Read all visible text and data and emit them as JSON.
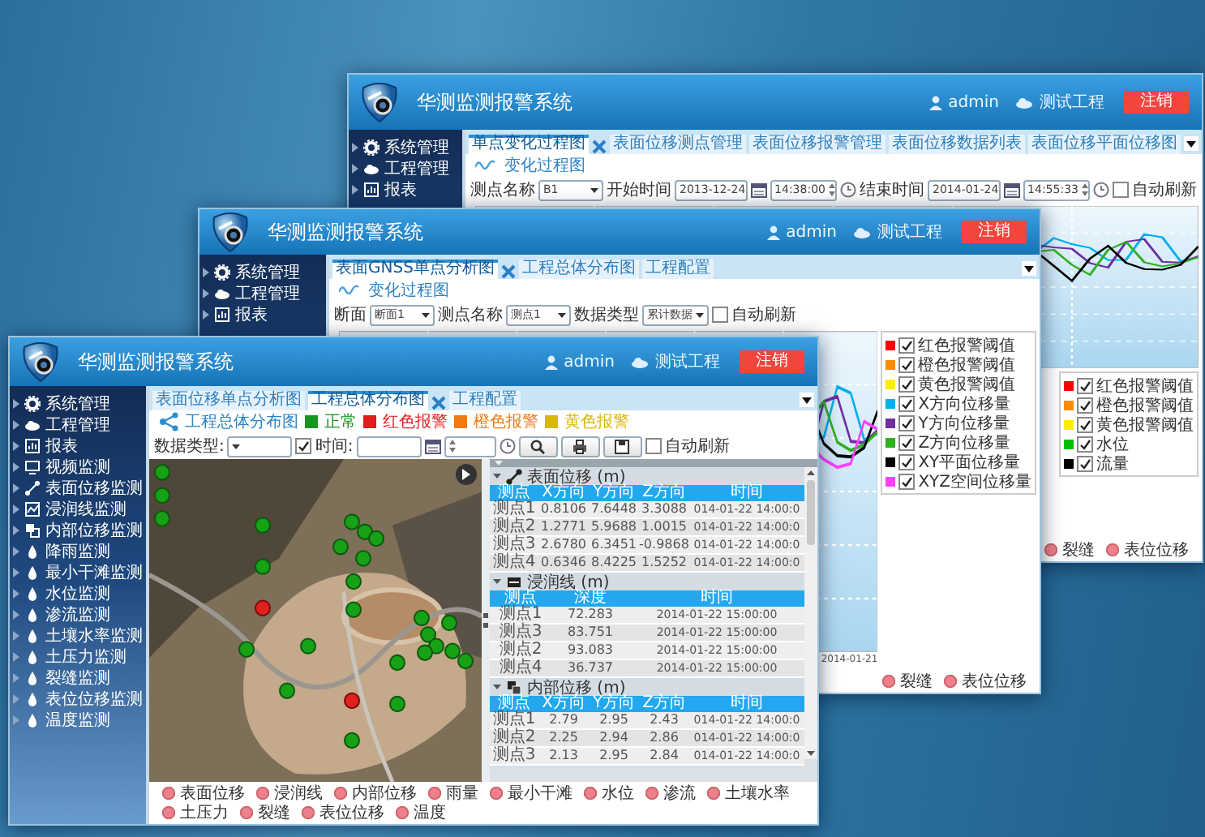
{
  "windows": [
    {
      "title": "华测监测报警系统",
      "user": "admin",
      "project": "测试工程",
      "logout": "注销",
      "sidebar": {
        "items": [
          "系统管理",
          "工程管理",
          "报表"
        ]
      },
      "tabs": [
        {
          "label": "单点变化过程图",
          "selected": true,
          "closable": true
        },
        {
          "label": "表面位移测点管理",
          "selected": false,
          "closable": false
        },
        {
          "label": "表面位移报警管理",
          "selected": false,
          "closable": false
        },
        {
          "label": "表面位移数据列表",
          "selected": false,
          "closable": false
        },
        {
          "label": "表面位移平面位移图",
          "selected": false,
          "closable": false
        }
      ],
      "content": {
        "kind": "chart",
        "title": "变化过程图",
        "toolbar": [
          {
            "kind": "label",
            "text": "测点名称"
          },
          {
            "kind": "select",
            "value": "B1"
          },
          {
            "kind": "label",
            "text": "开始时间"
          },
          {
            "kind": "date",
            "value": "2013-12-24"
          },
          {
            "kind": "time",
            "value": "14:38:00"
          },
          {
            "kind": "label",
            "text": "结束时间"
          },
          {
            "kind": "date",
            "value": "2014-01-24"
          },
          {
            "kind": "time",
            "value": "14:55:33"
          },
          {
            "kind": "checkbox",
            "label": "自动刷新",
            "checked": false
          }
        ],
        "legend": [
          {
            "label": "红色报警阈值",
            "color": "#ff0000",
            "checked": true
          },
          {
            "label": "橙色报警阈值",
            "color": "#ff8c00",
            "checked": true
          },
          {
            "label": "黄色报警阈值",
            "color": "#ffee00",
            "checked": true
          },
          {
            "label": "水位",
            "color": "#00c000",
            "checked": true
          },
          {
            "label": "流量",
            "color": "#000000",
            "checked": true
          }
        ],
        "layers": [
          "裂缝",
          "表位位移"
        ]
      }
    },
    {
      "title": "华测监测报警系统",
      "user": "admin",
      "project": "测试工程",
      "logout": "注销",
      "sidebar": {
        "items": [
          "系统管理",
          "工程管理",
          "报表"
        ]
      },
      "tabs": [
        {
          "label": "表面GNSS单点分析图",
          "selected": true,
          "closable": true
        },
        {
          "label": "工程总体分布图",
          "selected": false,
          "closable": false
        },
        {
          "label": "工程配置",
          "selected": false,
          "closable": false
        }
      ],
      "content": {
        "kind": "chart",
        "title": "变化过程图",
        "toolbar": [
          {
            "kind": "label",
            "text": "断面"
          },
          {
            "kind": "select",
            "value": "断面1"
          },
          {
            "kind": "label",
            "text": "测点名称"
          },
          {
            "kind": "select",
            "value": "测点1"
          },
          {
            "kind": "label",
            "text": "数据类型"
          },
          {
            "kind": "select",
            "value": "累计数据"
          },
          {
            "kind": "checkbox",
            "label": "自动刷新",
            "checked": false
          }
        ],
        "legend": [
          {
            "label": "红色报警阈值",
            "color": "#ff0000",
            "checked": true
          },
          {
            "label": "橙色报警阈值",
            "color": "#ff8c00",
            "checked": true
          },
          {
            "label": "黄色报警阈值",
            "color": "#ffee00",
            "checked": true
          },
          {
            "label": "X方向位移量",
            "color": "#00b0f0",
            "checked": true
          },
          {
            "label": "Y方向位移量",
            "color": "#7030a0",
            "checked": true
          },
          {
            "label": "Z方向位移量",
            "color": "#30b020",
            "checked": true
          },
          {
            "label": "XY平面位移量",
            "color": "#000000",
            "checked": true
          },
          {
            "label": "XYZ空间位移量",
            "color": "#ff40ff",
            "checked": true
          }
        ],
        "axis_label": "2014-01-21",
        "layers": [
          "裂缝",
          "表位位移"
        ]
      }
    },
    {
      "title": "华测监测报警系统",
      "user": "admin",
      "project": "测试工程",
      "logout": "注销",
      "sidebar": {
        "items": [
          "系统管理",
          "工程管理",
          "报表",
          "视频监测",
          "表面位移监测",
          "浸润线监测",
          "内部位移监测",
          "降雨监测",
          "最小干滩监测",
          "水位监测",
          "渗流监测",
          "土壤水率监测",
          "土压力监测",
          "裂缝监测",
          "表位位移监测",
          "温度监测"
        ]
      },
      "tabs": [
        {
          "label": "表面位移单点分析图",
          "selected": false,
          "closable": false
        },
        {
          "label": "工程总体分布图",
          "selected": true,
          "closable": true
        },
        {
          "label": "工程配置",
          "selected": false,
          "closable": false
        }
      ],
      "content": {
        "kind": "map",
        "title": "工程总体分布图",
        "status_legend": [
          {
            "label": "正常",
            "color": "#14961e"
          },
          {
            "label": "红色报警",
            "color": "#e51c1c"
          },
          {
            "label": "橙色报警",
            "color": "#f07a10"
          },
          {
            "label": "黄色报警",
            "color": "#d8b800"
          }
        ],
        "toolbar": [
          {
            "kind": "label",
            "text": "数据类型:"
          },
          {
            "kind": "select"
          },
          {
            "kind": "checkbox",
            "label": "时间:",
            "checked": true
          },
          {
            "kind": "date"
          },
          {
            "kind": "time"
          },
          {
            "kind": "search"
          },
          {
            "kind": "print"
          },
          {
            "kind": "save"
          },
          {
            "kind": "checkbox",
            "label": "自动刷新",
            "checked": false
          }
        ],
        "panels": [
          {
            "title": "表面位移 (m)",
            "columns": [
              "测点",
              "X方向",
              "Y方向",
              "Z方向",
              "时间"
            ],
            "rows": [
              [
                "测点1",
                "0.8106",
                "7.6448",
                "3.3088",
                "014-01-22 14:00:0"
              ],
              [
                "测点2",
                "1.2771",
                "5.9688",
                "1.0015",
                "014-01-22 14:00:0"
              ],
              [
                "测点3",
                "2.6780",
                "6.3451",
                "-0.9868",
                "014-01-22 14:00:0"
              ],
              [
                "测点4",
                "0.6346",
                "8.4225",
                "1.5252",
                "014-01-22 14:00:0"
              ]
            ]
          },
          {
            "title": "浸润线 (m)",
            "columns": [
              "测点",
              "深度",
              "时间"
            ],
            "rows": [
              [
                "测点1",
                "72.283",
                "2014-01-22 15:00:00"
              ],
              [
                "测点3",
                "83.751",
                "2014-01-22 15:00:00"
              ],
              [
                "测点2",
                "93.083",
                "2014-01-22 15:00:00"
              ],
              [
                "测点4",
                "36.737",
                "2014-01-22 15:00:00"
              ]
            ]
          },
          {
            "title": "内部位移 (m)",
            "columns": [
              "测点",
              "X方向",
              "Y方向",
              "Z方向",
              "时间"
            ],
            "rows": [
              [
                "测点1",
                "2.79",
                "2.95",
                "2.43",
                "014-01-22 14:00:0"
              ],
              [
                "测点2",
                "2.25",
                "2.94",
                "2.86",
                "014-01-22 14:00:0"
              ],
              [
                "测点3",
                "2.13",
                "2.95",
                "2.84",
                "014-01-22 14:00:0"
              ]
            ]
          }
        ],
        "layers": [
          "表面位移",
          "浸润线",
          "内部位移",
          "雨量",
          "最小干滩",
          "水位",
          "渗流",
          "土壤水率",
          "土压力",
          "裂缝",
          "表位位移",
          "温度"
        ]
      }
    }
  ]
}
